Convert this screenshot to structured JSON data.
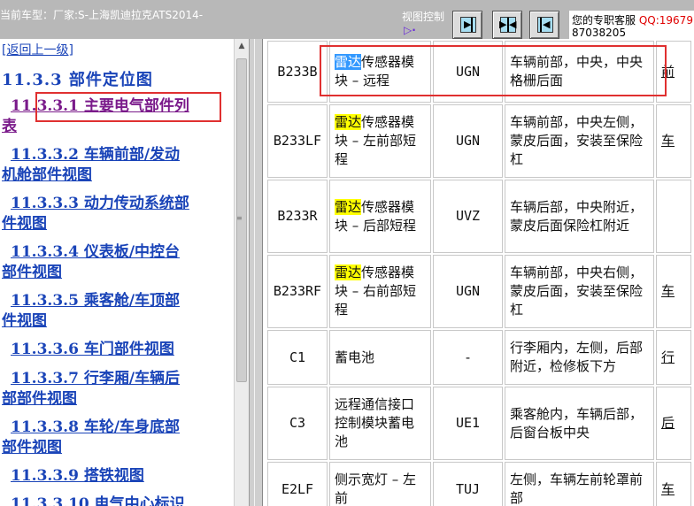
{
  "topbar": {
    "vehicle_label": "当前车型：厂家:S-上海凯迪拉克ATS2014-",
    "view_control_label": "视图控制",
    "view_arrow": "▷·",
    "service_label": "您的专职客服",
    "service_qq": "QQ:19679",
    "service_phone": "87038205"
  },
  "nav": {
    "back": "[返回上一级]",
    "title": "11.3.3 部件定位图",
    "links": [
      {
        "line1": "11.3.3.1 主要电气部件列",
        "line2": "表"
      },
      {
        "line1": "11.3.3.2 车辆前部/发动",
        "line2": "机舱部件视图"
      },
      {
        "line1": "11.3.3.3 动力传动系统部",
        "line2": "件视图"
      },
      {
        "line1": "11.3.3.4 仪表板/中控台",
        "line2": "部件视图"
      },
      {
        "line1": "11.3.3.5 乘客舱/车顶部",
        "line2": "件视图"
      },
      {
        "line1": "11.3.3.6 车门部件视图",
        "line2": ""
      },
      {
        "line1": "11.3.3.7 行李厢/车辆后",
        "line2": "部部件视图"
      },
      {
        "line1": "11.3.3.8 车轮/车身底部",
        "line2": "部件视图"
      },
      {
        "line1": "11.3.3.9 搭铁视图",
        "line2": ""
      },
      {
        "line1": "11.3.3.10 电气中心标识",
        "line2": ""
      }
    ]
  },
  "table": {
    "highlight_term": "雷达",
    "rows": [
      {
        "code": "B233B",
        "name_hl": "雷达",
        "name": "传感器模块 – 远程",
        "conn": "UGN",
        "location": "车辆前部，中央，中央格栅后面",
        "view": "前"
      },
      {
        "code": "B233LF",
        "name_hl": "雷达",
        "name": "传感器模块 – 左前部短程",
        "conn": "UGN",
        "location": "车辆前部，中央左侧，蒙皮后面，安装至保险杠",
        "view": "车"
      },
      {
        "code": "B233R",
        "name_hl": "雷达",
        "name": "传感器模块 – 后部短程",
        "conn": "UVZ",
        "location": "车辆后部，中央附近，蒙皮后面保险杠附近",
        "view": ""
      },
      {
        "code": "B233RF",
        "name_hl": "雷达",
        "name": "传感器模块 – 右前部短程",
        "conn": "UGN",
        "location": "车辆前部，中央右侧，蒙皮后面，安装至保险杠",
        "view": "车"
      },
      {
        "code": "C1",
        "name_hl": "",
        "name": "蓄电池",
        "conn": "-",
        "location": "行李厢内，左侧，后部附近，检修板下方",
        "view": "行"
      },
      {
        "code": "C3",
        "name_hl": "",
        "name": "远程通信接口控制模块蓄电池",
        "conn": "UE1",
        "location": "乘客舱内，车辆后部，后窗台板中央",
        "view": "后"
      },
      {
        "code": "E2LF",
        "name_hl": "",
        "name": "侧示宽灯 – 左前",
        "conn": "TUJ",
        "location": "左侧，车辆左前轮罩前部",
        "view": "车"
      }
    ]
  }
}
